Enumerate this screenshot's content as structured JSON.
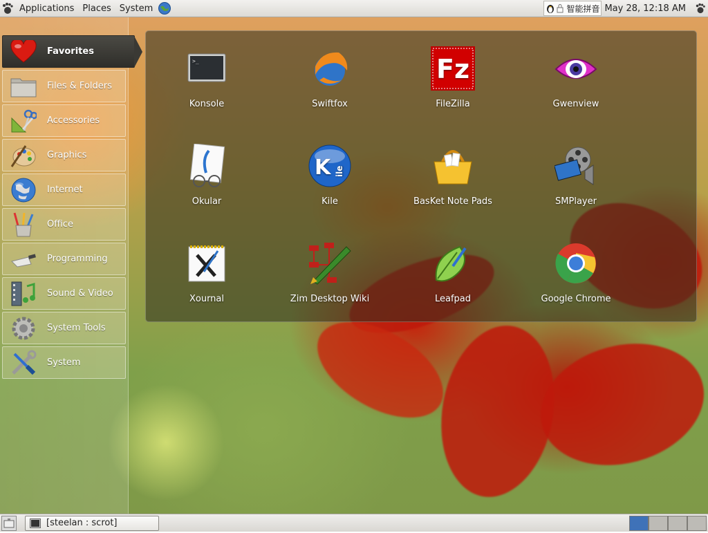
{
  "top_panel": {
    "menus": [
      "Applications",
      "Places",
      "System"
    ],
    "input_method": "智能拼音",
    "clock": "May 28, 12:18 AM"
  },
  "categories": [
    {
      "label": "Favorites",
      "icon": "heart-icon",
      "active": true
    },
    {
      "label": "Files & Folders",
      "icon": "folder-icon"
    },
    {
      "label": "Accessories",
      "icon": "scissors-ruler-icon"
    },
    {
      "label": "Graphics",
      "icon": "paint-palette-icon"
    },
    {
      "label": "Internet",
      "icon": "globe-icon"
    },
    {
      "label": "Office",
      "icon": "pencil-cup-icon"
    },
    {
      "label": "Programming",
      "icon": "trowel-icon"
    },
    {
      "label": "Sound & Video",
      "icon": "film-music-icon"
    },
    {
      "label": "System Tools",
      "icon": "gear-icon"
    },
    {
      "label": "System",
      "icon": "wrench-screwdriver-icon"
    }
  ],
  "apps": [
    {
      "label": "Konsole",
      "icon": "terminal-icon"
    },
    {
      "label": "Swiftfox",
      "icon": "swiftfox-icon"
    },
    {
      "label": "FileZilla",
      "icon": "filezilla-icon"
    },
    {
      "label": "Gwenview",
      "icon": "eye-icon"
    },
    {
      "label": "Okular",
      "icon": "okular-icon"
    },
    {
      "label": "Kile",
      "icon": "kile-icon"
    },
    {
      "label": "BasKet Note Pads",
      "icon": "basket-icon"
    },
    {
      "label": "SMPlayer",
      "icon": "film-reel-icon"
    },
    {
      "label": "Xournal",
      "icon": "xournal-icon"
    },
    {
      "label": "Zim Desktop Wiki",
      "icon": "zim-pen-icon"
    },
    {
      "label": "Leafpad",
      "icon": "leaf-icon"
    },
    {
      "label": "Google Chrome",
      "icon": "chrome-icon"
    }
  ],
  "taskbar": {
    "task_label": "[steelan : scrot]"
  },
  "workspaces": {
    "count": 4,
    "active_index": 0
  },
  "colors": {
    "active_workspace": "#3f72b8",
    "active_category_bg": "#3a3934"
  }
}
